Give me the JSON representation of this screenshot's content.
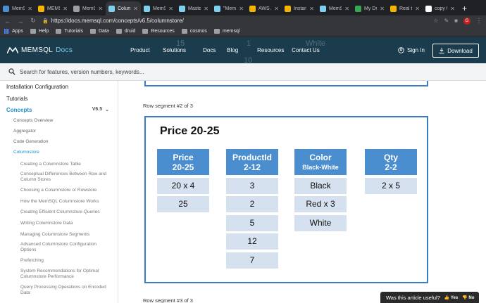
{
  "browser": {
    "tabs": [
      {
        "label": "MemS",
        "color": "#4a8ed0",
        "active": false
      },
      {
        "label": "MEMSQ",
        "color": "#f4b400",
        "active": false
      },
      {
        "label": "MemS",
        "color": "#9aa0a6",
        "active": false
      },
      {
        "label": "Colum",
        "color": "#7fd0f0",
        "active": true
      },
      {
        "label": "MemS",
        "color": "#7fd0f0",
        "active": false
      },
      {
        "label": "Master",
        "color": "#7fd0f0",
        "active": false
      },
      {
        "label": "\"MemS",
        "color": "#7fd0f0",
        "active": false
      },
      {
        "label": "AWS A",
        "color": "#f4b400",
        "active": false
      },
      {
        "label": "Instanc",
        "color": "#f4b400",
        "active": false
      },
      {
        "label": "MemS",
        "color": "#7fd0f0",
        "active": false
      },
      {
        "label": "My Dri",
        "color": "#34a853",
        "active": false
      },
      {
        "label": "Real ti",
        "color": "#f4b400",
        "active": false
      },
      {
        "label": "copy ta",
        "color": "#ffffff",
        "active": false
      }
    ],
    "url": "https://docs.memsql.com/concepts/v6.5/columnstore/",
    "avatar_letter": "G",
    "bookmarks": [
      {
        "label": "Apps",
        "icon": "apps-grid-icon"
      },
      {
        "label": "Help",
        "icon": "folder-icon"
      },
      {
        "label": "Tutorials",
        "icon": "folder-icon"
      },
      {
        "label": "Data",
        "icon": "folder-icon"
      },
      {
        "label": "druid",
        "icon": "folder-icon"
      },
      {
        "label": "Resources",
        "icon": "folder-icon"
      },
      {
        "label": "cosmos",
        "icon": "folder-icon"
      },
      {
        "label": "memsql",
        "icon": "folder-icon"
      }
    ]
  },
  "site": {
    "logo_text": "MEMSQL",
    "logo_docs": "Docs",
    "nav": [
      "Product",
      "Solutions",
      "Docs",
      "Blog",
      "Resources",
      "Contact Us"
    ],
    "signin": "Sign In",
    "download": "Download",
    "ghost_text": [
      "15",
      "1",
      "White",
      "10"
    ]
  },
  "search": {
    "placeholder": "Search for features, version numbers, keywords..."
  },
  "sidebar": {
    "items": [
      {
        "label": "Installation Configuration",
        "level": 0,
        "active": false
      },
      {
        "label": "Tutorials",
        "level": 0,
        "active": false
      },
      {
        "label": "Concepts",
        "level": 0,
        "active": true,
        "version": "V6.5"
      },
      {
        "label": "Concepts Overview",
        "level": 1,
        "active": false
      },
      {
        "label": "Aggregator",
        "level": 1,
        "active": false
      },
      {
        "label": "Code Generation",
        "level": 1,
        "active": false
      },
      {
        "label": "Columnstore",
        "level": 1,
        "active": true
      },
      {
        "label": "Creating a Columnstore Table",
        "level": 2,
        "active": false
      },
      {
        "label": "Conceptual Differences Between Row and Column Stores",
        "level": 2,
        "active": false
      },
      {
        "label": "Choosing a Columnstore or Rowstore",
        "level": 2,
        "active": false
      },
      {
        "label": "How the MemSQL Columnstore Works",
        "level": 2,
        "active": false
      },
      {
        "label": "Creating Efficient Columnstore Queries",
        "level": 2,
        "active": false
      },
      {
        "label": "Writing Columnstore Data",
        "level": 2,
        "active": false
      },
      {
        "label": "Managing Columnstore Segments",
        "level": 2,
        "active": false
      },
      {
        "label": "Advanced Columnstore Configuration Options",
        "level": 2,
        "active": false
      },
      {
        "label": "Prefetching",
        "level": 2,
        "active": false
      },
      {
        "label": "System Recommendations for Optimal Columnstore Performance",
        "level": 2,
        "active": false
      },
      {
        "label": "Query Processing Operations on Encoded Data",
        "level": 2,
        "active": false
      }
    ]
  },
  "content": {
    "segment_label": "Row segment #2 of 3",
    "next_segment_label": "Row segment #3 of 3",
    "segment_title": "Price 20-25",
    "columns": [
      {
        "name": "Price",
        "range": "20-25",
        "cells": [
          "20 x 4",
          "25"
        ]
      },
      {
        "name": "ProductId",
        "range": "2-12",
        "cells": [
          "3",
          "2",
          "5",
          "12",
          "7"
        ]
      },
      {
        "name": "Color",
        "range": "Black-White",
        "cells": [
          "Black",
          "Red x 3",
          "White"
        ]
      },
      {
        "name": "Qty",
        "range": "2-2",
        "cells": [
          "2 x 5"
        ]
      }
    ]
  },
  "feedback": {
    "question": "Was this article useful?",
    "yes": "Yes",
    "no": "No"
  }
}
